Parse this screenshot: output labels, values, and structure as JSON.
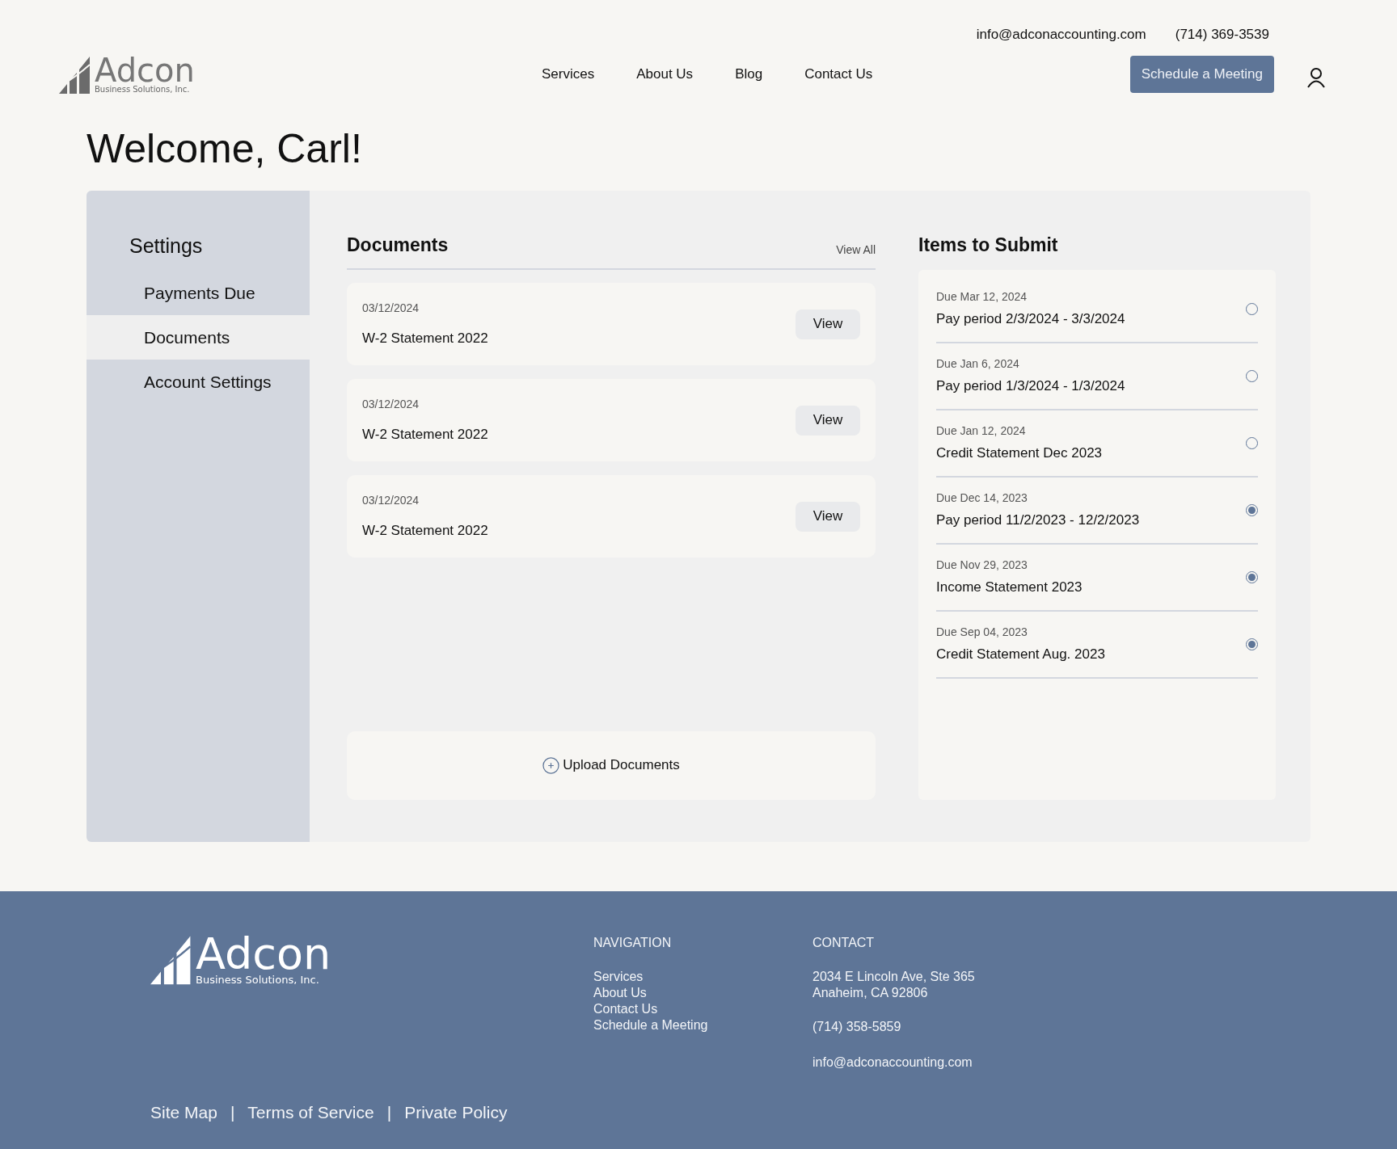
{
  "header": {
    "logo": {
      "name": "Adcon",
      "tagline": "Business Solutions, Inc."
    },
    "email": "info@adconaccounting.com",
    "phone": "(714) 369-3539",
    "nav": [
      "Services",
      "About Us",
      "Blog",
      "Contact Us"
    ],
    "cta": "Schedule a Meeting"
  },
  "welcome": "Welcome, Carl!",
  "sidebar": {
    "title": "Settings",
    "items": [
      {
        "label": "Payments Due",
        "selected": false
      },
      {
        "label": "Documents",
        "selected": true
      },
      {
        "label": "Account Settings",
        "selected": false
      }
    ]
  },
  "documents": {
    "title": "Documents",
    "view_all": "View All",
    "items": [
      {
        "date": "03/12/2024",
        "name": "W-2 Statement 2022",
        "action": "View"
      },
      {
        "date": "03/12/2024",
        "name": "W-2 Statement 2022",
        "action": "View"
      },
      {
        "date": "03/12/2024",
        "name": "W-2 Statement 2022",
        "action": "View"
      }
    ],
    "upload": "Upload Documents"
  },
  "items_to_submit": {
    "title": "Items to Submit",
    "items": [
      {
        "due": "Due Mar 12, 2024",
        "name": "Pay period 2/3/2024 - 3/3/2024",
        "checked": false
      },
      {
        "due": "Due Jan 6, 2024",
        "name": "Pay period 1/3/2024 - 1/3/2024",
        "checked": false
      },
      {
        "due": "Due Jan 12, 2024",
        "name": "Credit Statement Dec 2023",
        "checked": false
      },
      {
        "due": "Due Dec 14, 2023",
        "name": "Pay period 11/2/2023 - 12/2/2023",
        "checked": true
      },
      {
        "due": "Due Nov 29, 2023",
        "name": "Income Statement 2023",
        "checked": true
      },
      {
        "due": "Due Sep 04, 2023",
        "name": "Credit Statement Aug. 2023",
        "checked": true
      }
    ]
  },
  "footer": {
    "logo": {
      "name": "Adcon",
      "tagline": "Business Solutions, Inc."
    },
    "navigation": {
      "title": "NAVIGATION",
      "links": [
        "Services",
        "About Us",
        "Contact Us",
        "Schedule a Meeting"
      ]
    },
    "contact": {
      "title": "CONTACT",
      "address": [
        "2034 E Lincoln Ave, Ste 365",
        "Anaheim, CA 92806"
      ],
      "phone": "(714) 358-5859",
      "email": "info@adconaccounting.com"
    },
    "bottom_links": [
      "Site Map",
      "Terms of Service",
      "Private Policy"
    ],
    "separator": "|"
  }
}
